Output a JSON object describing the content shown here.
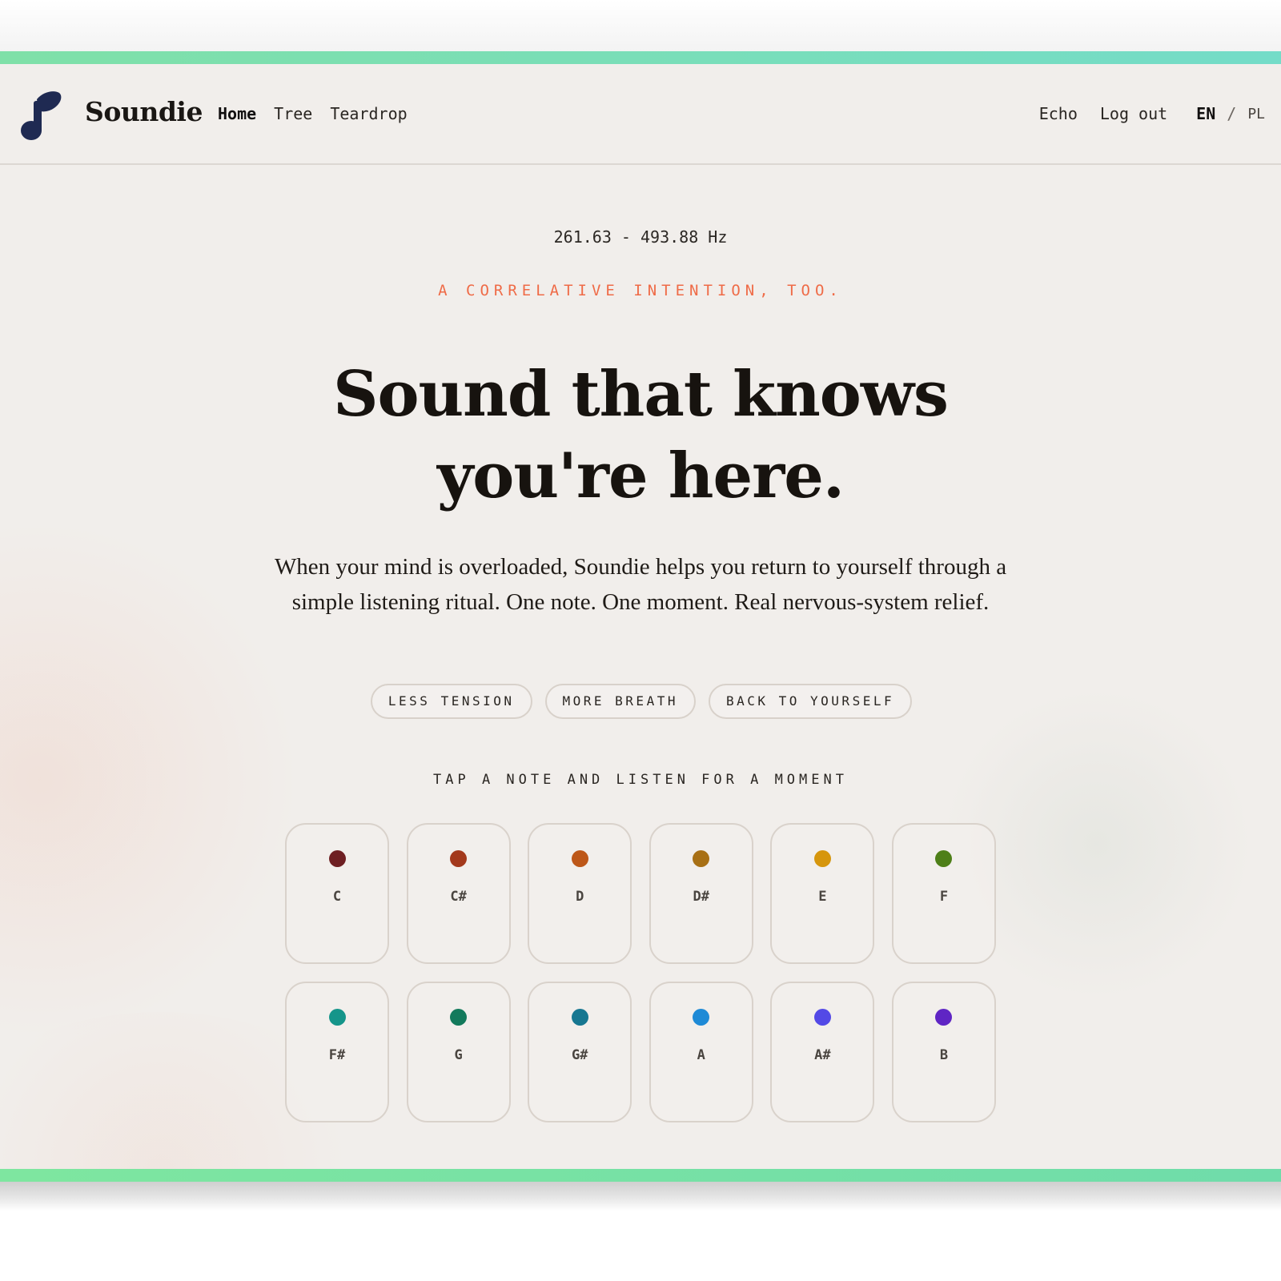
{
  "brand": {
    "name": "Soundie",
    "logo_icon": "music-note-icon",
    "logo_color": "#1f2a52"
  },
  "nav": {
    "left": [
      {
        "label": "Home",
        "active": true
      },
      {
        "label": "Tree",
        "active": false
      },
      {
        "label": "Teardrop",
        "active": false
      }
    ],
    "right": {
      "echo": "Echo",
      "logout": "Log out"
    },
    "lang": {
      "active": "EN",
      "separator": "/",
      "other": "PL"
    }
  },
  "hero": {
    "frequency_range": "261.63 - 493.88 Hz",
    "kicker": "A CORRELATIVE INTENTION, TOO.",
    "headline_line1": "Sound that knows",
    "headline_line2": "you're here.",
    "subtitle": "When your mind is overloaded, Soundie helps you return to yourself through a simple listening ritual. One note. One moment. Real nervous-system relief.",
    "pills": [
      "LESS TENSION",
      "MORE BREATH",
      "BACK TO YOURSELF"
    ],
    "tap_label": "TAP A NOTE AND LISTEN FOR A MOMENT"
  },
  "notes": [
    {
      "name": "C",
      "color": "#6e1f22"
    },
    {
      "name": "C#",
      "color": "#a3391c"
    },
    {
      "name": "D",
      "color": "#bd5718"
    },
    {
      "name": "D#",
      "color": "#a87015"
    },
    {
      "name": "E",
      "color": "#d6960d"
    },
    {
      "name": "F",
      "color": "#4e7f18"
    },
    {
      "name": "F#",
      "color": "#15958a"
    },
    {
      "name": "G",
      "color": "#137a5c"
    },
    {
      "name": "G#",
      "color": "#177791"
    },
    {
      "name": "A",
      "color": "#1e8ad6"
    },
    {
      "name": "A#",
      "color": "#5349e6"
    },
    {
      "name": "B",
      "color": "#5f25c4"
    }
  ],
  "theme": {
    "accent_kicker": "#ef6b47",
    "accent_bar": "#7fe0a8",
    "background": "#f1eeeb"
  }
}
